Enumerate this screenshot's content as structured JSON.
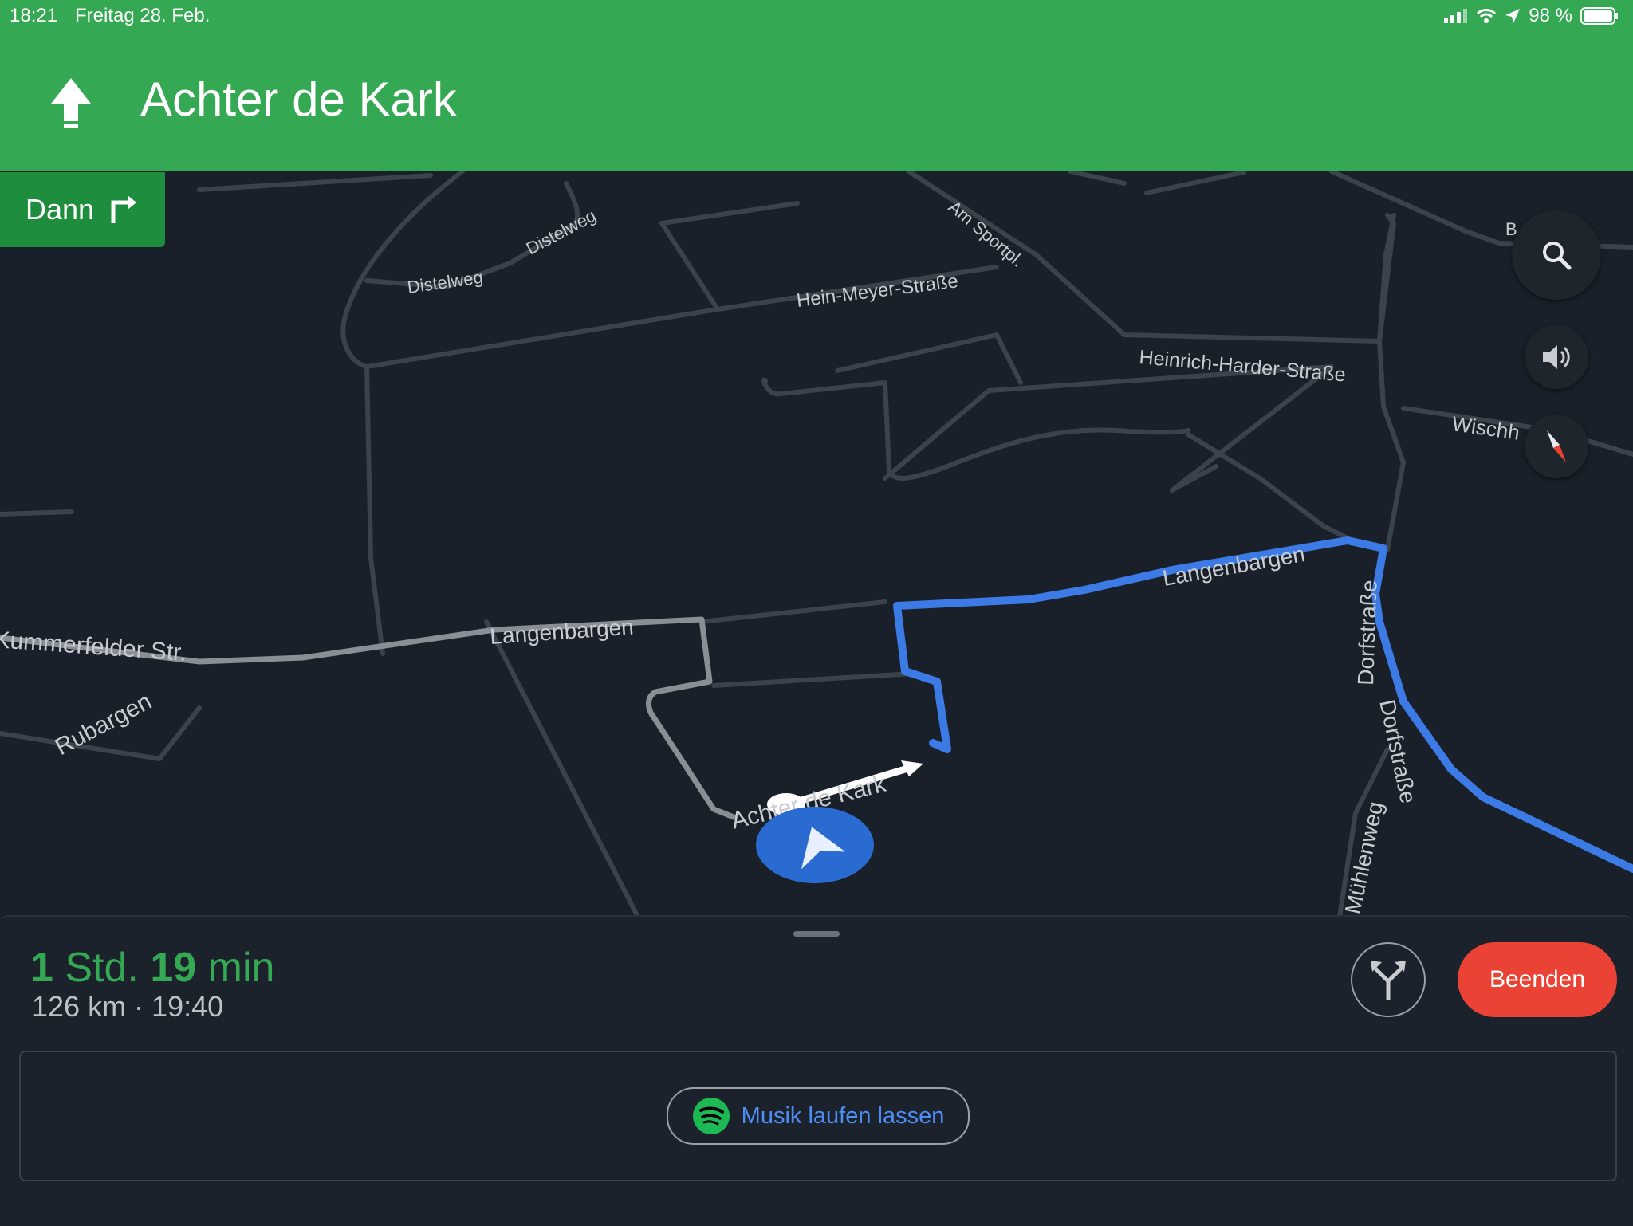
{
  "status_bar": {
    "time": "18:21",
    "date": "Freitag 28. Feb.",
    "battery": "98 %"
  },
  "navigation": {
    "current_street": "Achter de Kark",
    "then_label": "Dann",
    "next_maneuver_icon": "turn-right-icon",
    "current_maneuver_icon": "straight-arrow-icon"
  },
  "map": {
    "labels": {
      "distelweg_1": "Distelweg",
      "distelweg_2": "Distelweg",
      "am_sportpl": "Am Sportpl.",
      "hein_meyer": "Hein-Meyer-Straße",
      "heinrich_harder": "Heinrich-Harder-Straße",
      "wischhof": "Wischh",
      "b_label": "B",
      "langenbargen_1": "Langenbargen",
      "langenbargen_2": "Langenbargen",
      "kummerfelder": "Kummerfelder Str.",
      "rubargen": "Rubargen",
      "dorfstrasse": "Dorfstraße",
      "muehlenweg": "Mühlenweg",
      "achter_de_kark": "Achter de Kark"
    },
    "route_color": "#3c7be6",
    "road_color": "#3a424c"
  },
  "controls": {
    "search_icon": "search-icon",
    "sound_icon": "speaker-icon",
    "compass_icon": "compass-icon"
  },
  "trip": {
    "eta_hours": "1",
    "eta_hours_unit": "Std.",
    "eta_minutes": "19",
    "eta_minutes_unit": "min",
    "distance_arrival": "126 km · 19:40",
    "end_label": "Beenden",
    "alternate_routes_icon": "alternate-routes-icon"
  },
  "music": {
    "label": "Musik laufen lassen",
    "icon": "spotify-icon",
    "accent": "#1db954"
  },
  "colors": {
    "header_green": "#34a853",
    "then_green": "#1e8e3e",
    "end_red": "#ea4335",
    "eta_green": "#34a853"
  }
}
